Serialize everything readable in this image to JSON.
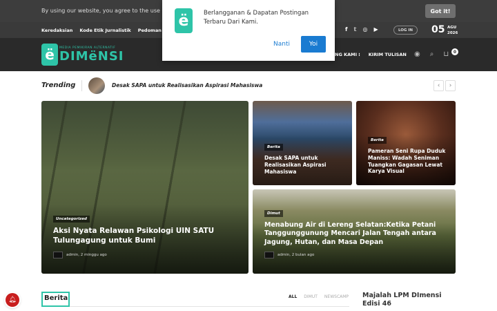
{
  "cookie": {
    "text": "By using our website, you agree to the use of our",
    "button": "Got it!"
  },
  "topbar": {
    "links": [
      "Keredaksian",
      "Kode Etik Jurnalistik",
      "Pedoman Me"
    ],
    "social_icons": [
      "facebook-icon",
      "twitter-icon",
      "instagram-icon",
      "youtube-icon"
    ],
    "login": "LOG IN",
    "date_day": "05",
    "date_month": "AGU",
    "date_year": "2026"
  },
  "header": {
    "logo_tagline": "MEDIA PEMIKIRAN ALTERNATIF",
    "logo_name": "DIMëNSI",
    "nav": [
      "ANG KAMI ⁝",
      "KIRIM TULISAN"
    ],
    "cart_count": "0"
  },
  "popup": {
    "message": "Berlangganan & Dapatan Postingan Terbaru Dari Kami.",
    "no_label": "Nanti",
    "yes_label": "Yoi"
  },
  "trending": {
    "label": "Trending",
    "title": "Desak SAPA untuk Realisasikan Aspirasi Mahasiswa"
  },
  "cards": [
    {
      "category": "Uncategorized",
      "title": "Aksi Nyata Relawan Psikologi UIN SATU Tulungagung untuk Bumi",
      "meta": "admin, 2 minggu ago"
    },
    {
      "category": "Berita",
      "title": "Desak SAPA untuk Realisasikan Aspirasi Mahasiswa"
    },
    {
      "category": "Berita",
      "title": "Pameran Seni Rupa Duduk Maniss: Wadah Seniman Tuangkan Gagasan Lewat Karya Visual"
    },
    {
      "category": "Dimut",
      "title": "Menabung Air di Lereng Selatan:Ketika Petani Tanggunggunung Mencari Jalan Tengah antara Jagung, Hutan, dan Masa Depan",
      "meta": "admin, 2 bulan ago"
    }
  ],
  "section": {
    "title": "Berita",
    "tabs": [
      "ALL",
      "DIMUT",
      "NEWSCAMP"
    ]
  },
  "sidebar": {
    "title": "Majalah LPM DImensi Edisi 46"
  },
  "colors": {
    "accent": "#2ec4a8",
    "popup_button": "#1a7bd1",
    "header_bg": "#2a2a2a"
  }
}
